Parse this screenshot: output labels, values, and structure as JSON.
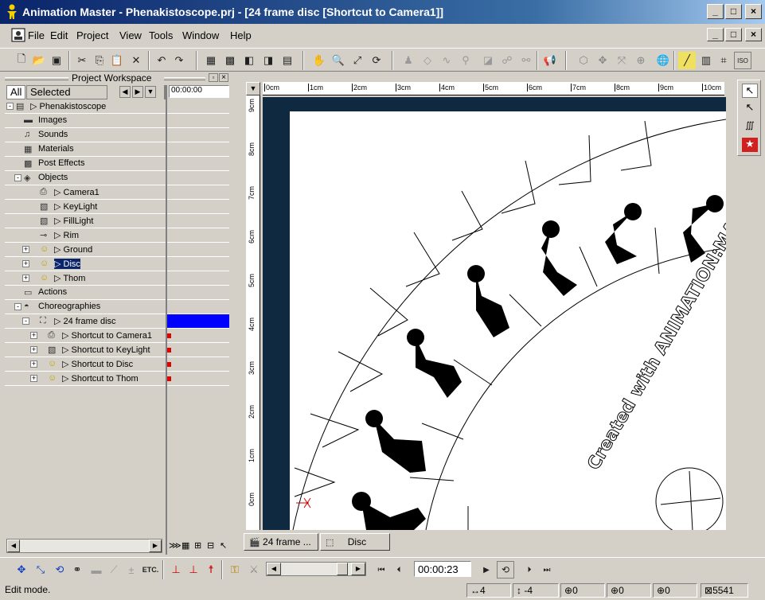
{
  "window": {
    "title": "Animation Master - Phenakistoscope.prj - [24 frame disc [Shortcut to Camera1]]",
    "controls": [
      "_",
      "□",
      "×"
    ]
  },
  "menu": [
    "File",
    "Edit",
    "Project",
    "View",
    "Tools",
    "Window",
    "Help"
  ],
  "workspace": {
    "title": "Project Workspace",
    "tab_all": "All",
    "tab_selected": "Selected",
    "timecode": "00:00:00",
    "tree": [
      {
        "label": "Phenakistoscope",
        "level": 0,
        "expander": "-",
        "icon": "project-icon"
      },
      {
        "label": "Images",
        "level": 1,
        "expander": "",
        "icon": "images-folder-icon"
      },
      {
        "label": "Sounds",
        "level": 1,
        "expander": "",
        "icon": "sounds-folder-icon"
      },
      {
        "label": "Materials",
        "level": 1,
        "expander": "",
        "icon": "materials-folder-icon"
      },
      {
        "label": "Post Effects",
        "level": 1,
        "expander": "",
        "icon": "post-effects-icon"
      },
      {
        "label": "Objects",
        "level": 1,
        "expander": "-",
        "icon": "objects-folder-icon"
      },
      {
        "label": "Camera1",
        "level": 2,
        "expander": "",
        "icon": "camera-icon"
      },
      {
        "label": "KeyLight",
        "level": 2,
        "expander": "",
        "icon": "light-icon"
      },
      {
        "label": "FillLight",
        "level": 2,
        "expander": "",
        "icon": "light-icon"
      },
      {
        "label": "Rim",
        "level": 2,
        "expander": "",
        "icon": "spotlight-icon"
      },
      {
        "label": "Ground",
        "level": 2,
        "expander": "+",
        "icon": "model-icon"
      },
      {
        "label": "Disc",
        "level": 2,
        "expander": "+",
        "icon": "model-icon",
        "selected": true
      },
      {
        "label": "Thom",
        "level": 2,
        "expander": "+",
        "icon": "model-icon"
      },
      {
        "label": "Actions",
        "level": 1,
        "expander": "",
        "icon": "actions-folder-icon"
      },
      {
        "label": "Choreographies",
        "level": 1,
        "expander": "-",
        "icon": "choreography-folder-icon"
      },
      {
        "label": "24 frame disc",
        "level": 2,
        "expander": "-",
        "icon": "choreography-icon"
      },
      {
        "label": "Shortcut to Camera1",
        "level": 3,
        "expander": "+",
        "icon": "camera-icon"
      },
      {
        "label": "Shortcut to KeyLight",
        "level": 3,
        "expander": "+",
        "icon": "light-icon"
      },
      {
        "label": "Shortcut to Disc",
        "level": 3,
        "expander": "+",
        "icon": "model-icon"
      },
      {
        "label": "Shortcut to Thom",
        "level": 3,
        "expander": "+",
        "icon": "model-icon"
      }
    ]
  },
  "viewport": {
    "ruler_h": [
      "0cm",
      "1cm",
      "2cm",
      "3cm",
      "4cm",
      "5cm",
      "6cm",
      "7cm",
      "8cm",
      "9cm",
      "10cm"
    ],
    "ruler_v": [
      "9cm",
      "8cm",
      "7cm",
      "6cm",
      "5cm",
      "4cm",
      "3cm",
      "2cm",
      "1cm",
      "0cm"
    ],
    "disc_text": "Created with ANIMATION:MASTER"
  },
  "doc_tabs": [
    "24 frame ...",
    "Disc"
  ],
  "playback": {
    "timecode": "00:00:23",
    "etc_label": "ETC."
  },
  "status": {
    "mode": "Edit mode.",
    "x": "4",
    "y": "-4",
    "f1": "0",
    "f2": "0",
    "f3": "0",
    "count": "5541"
  }
}
